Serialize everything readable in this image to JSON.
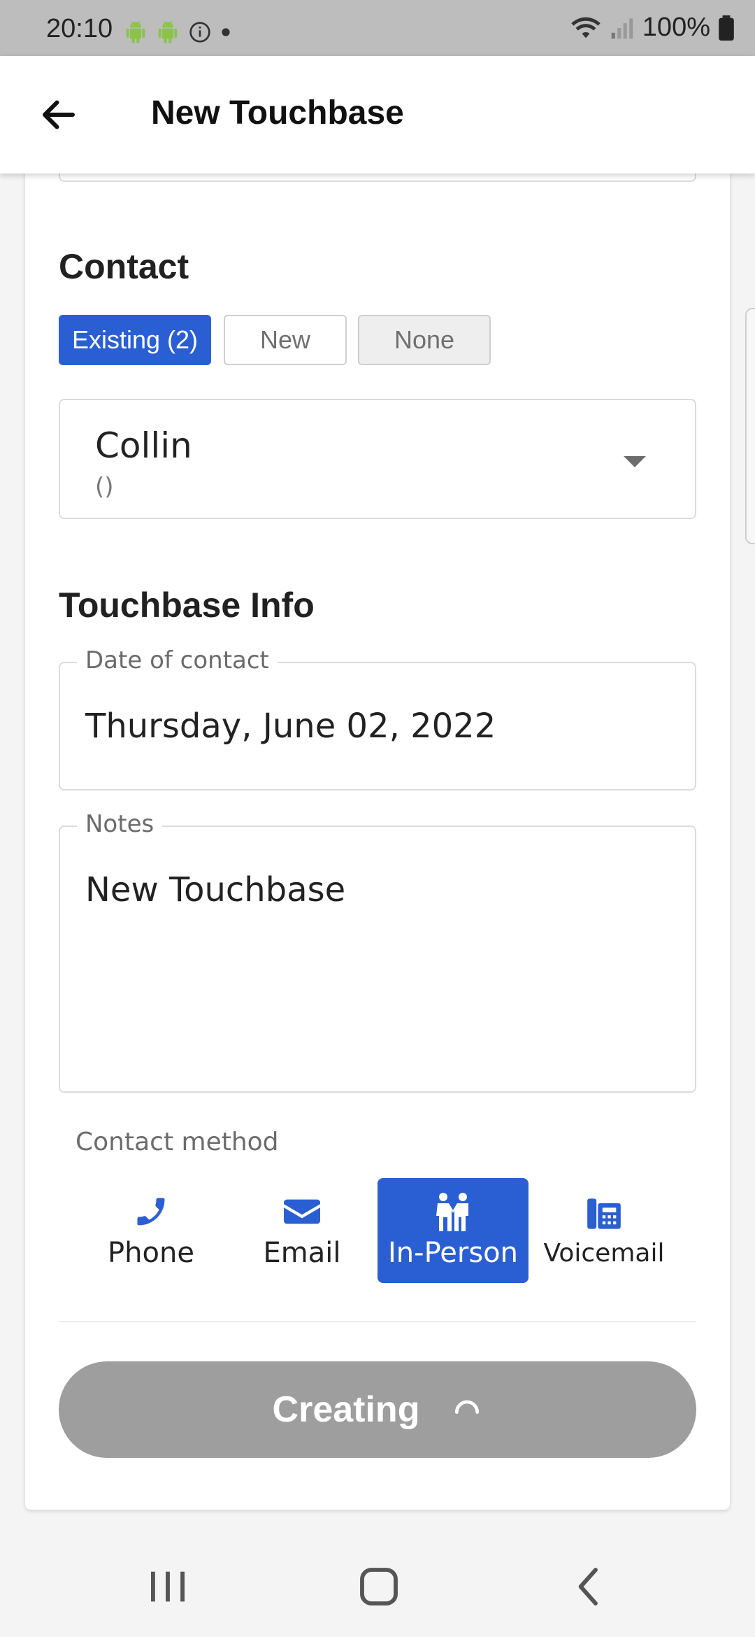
{
  "status_bar": {
    "time": "20:10",
    "battery": "100%"
  },
  "app_bar": {
    "title": "New Touchbase"
  },
  "contact": {
    "heading": "Contact",
    "segments": [
      {
        "label": "Existing (2)",
        "state": "active"
      },
      {
        "label": "New",
        "state": "outline"
      },
      {
        "label": "None",
        "state": "grey"
      }
    ],
    "selected_name": "Collin",
    "selected_sub": "()"
  },
  "touchbase_info": {
    "heading": "Touchbase Info",
    "date_label": "Date of contact",
    "date_value": "Thursday, June 02, 2022",
    "notes_label": "Notes",
    "notes_value": "New Touchbase"
  },
  "contact_method": {
    "label": "Contact method",
    "options": [
      {
        "label": "Phone",
        "icon": "phone-icon",
        "selected": false
      },
      {
        "label": "Email",
        "icon": "envelope-icon",
        "selected": false
      },
      {
        "label": "In-Person",
        "icon": "people-icon",
        "selected": true
      },
      {
        "label": "Voicemail",
        "icon": "voicemail-icon",
        "selected": false
      }
    ]
  },
  "submit": {
    "label": "Creating"
  },
  "colors": {
    "accent": "#2a5fd4",
    "disabled_button": "#9e9e9e"
  }
}
